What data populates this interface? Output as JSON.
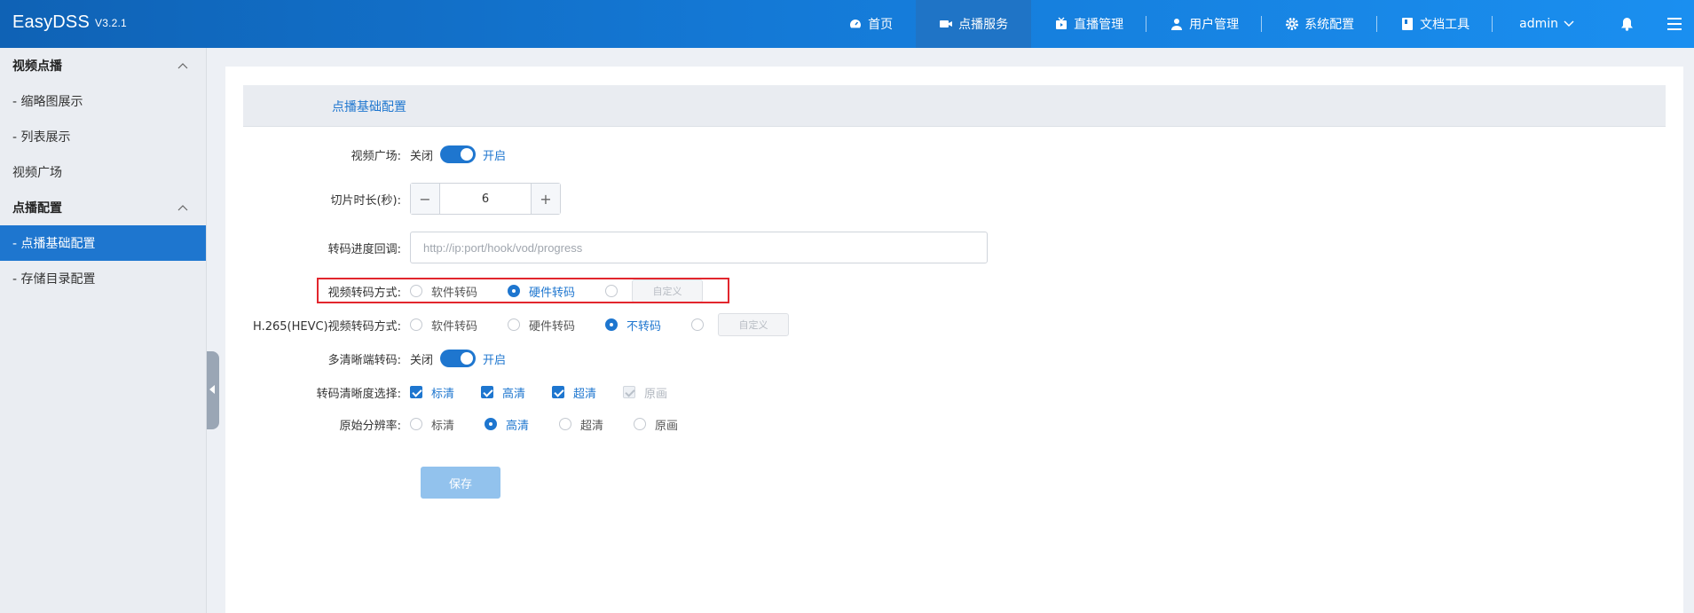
{
  "app": {
    "name": "EasyDSS",
    "version": "V3.2.1"
  },
  "nav": {
    "home": "首页",
    "vod": "点播服务",
    "live": "直播管理",
    "users": "用户管理",
    "system": "系统配置",
    "docs": "文档工具",
    "user": "admin"
  },
  "sidebar": {
    "group1": "视频点播",
    "item_thumb": "- 缩略图展示",
    "item_list": "- 列表展示",
    "item_square": "视频广场",
    "group2": "点播配置",
    "item_basic": "- 点播基础配置",
    "item_storage": "- 存储目录配置"
  },
  "panel": {
    "title": "点播基础配置"
  },
  "form": {
    "square_label": "视频广场:",
    "off": "关闭",
    "on": "开启",
    "slice_label": "切片时长(秒):",
    "slice_value": "6",
    "progress_label": "转码进度回调:",
    "progress_placeholder": "http://ip:port/hook/vod/progress",
    "transcode_label": "视频转码方式:",
    "software": "软件转码",
    "hardware": "硬件转码",
    "custom": "自定义",
    "hevc_label": "H.265(HEVC)视频转码方式:",
    "no_transcode": "不转码",
    "multi_label": "多清晰端转码:",
    "res_label": "转码清晰度选择:",
    "sd": "标清",
    "hd": "高清",
    "uhd": "超清",
    "orig": "原画",
    "orig_res_label": "原始分辨率:",
    "save": "保存"
  },
  "colors": {
    "accent": "#1e76cf",
    "highlight": "#e2262d",
    "nav_bg": "#1479d6"
  }
}
